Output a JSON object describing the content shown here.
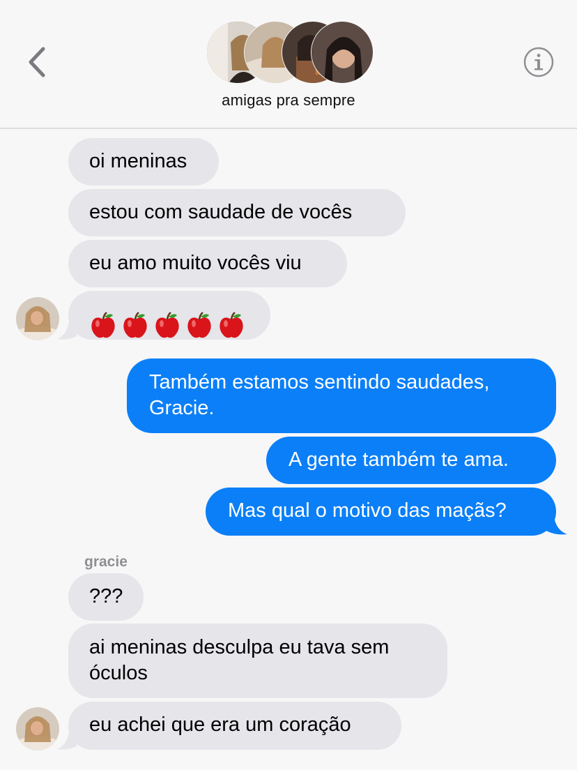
{
  "header": {
    "back_icon": "chevron-left-icon",
    "info_icon": "info-icon",
    "group_name": "amigas pra sempre"
  },
  "messages": {
    "m1": "oi meninas",
    "m2": "estou com saudade de vocês",
    "m3": "eu amo muito vocês viu",
    "m4_emoji": "apple-icon",
    "m5": "Também estamos sentindo saudades, Gracie.",
    "m6": "A gente também te ama.",
    "m7": "Mas qual o motivo das maçãs?",
    "sender": "gracie",
    "m8": "???",
    "m9": "ai meninas desculpa eu tava sem óculos",
    "m10": "eu achei que era um coração"
  },
  "colors": {
    "incoming_bubble": "#e5e5ea",
    "outgoing_bubble": "#0b7ff7",
    "background": "#f7f7f7"
  }
}
